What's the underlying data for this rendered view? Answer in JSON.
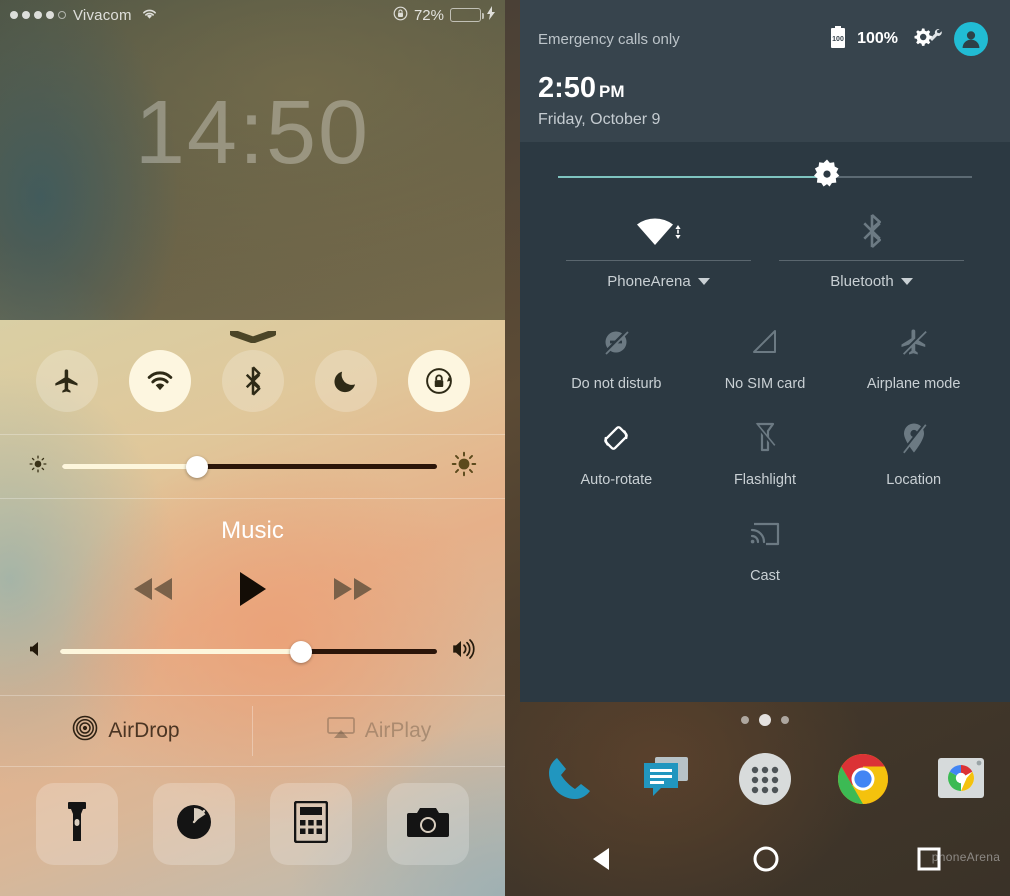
{
  "ios": {
    "status": {
      "signal_dots_filled": 4,
      "signal_dots_total": 5,
      "carrier": "Vivacom",
      "wifi_icon": "wifi-icon",
      "lock_icon": "rotation-lock-icon",
      "battery_percent": "72%",
      "battery_level": 72,
      "charging": true
    },
    "lock_clock": "14:50",
    "control_center": {
      "toggles": [
        {
          "name": "airplane-mode",
          "icon": "airplane-icon",
          "active": false
        },
        {
          "name": "wifi",
          "icon": "wifi-icon",
          "active": true
        },
        {
          "name": "bluetooth",
          "icon": "bluetooth-icon",
          "active": false
        },
        {
          "name": "do-not-disturb",
          "icon": "moon-icon",
          "active": false
        },
        {
          "name": "rotation-lock",
          "icon": "rotation-lock-icon",
          "active": true
        }
      ],
      "brightness": {
        "label": "Brightness",
        "value": 36
      },
      "music": {
        "title": "Music",
        "prev_label": "Previous",
        "play_label": "Play",
        "next_label": "Next",
        "volume": 64
      },
      "share": [
        {
          "label": "AirDrop",
          "icon": "airdrop-icon",
          "enabled": true
        },
        {
          "label": "AirPlay",
          "icon": "airplay-icon",
          "enabled": false
        }
      ],
      "apps": [
        {
          "label": "Flashlight",
          "icon": "flashlight-icon"
        },
        {
          "label": "Timer",
          "icon": "timer-icon"
        },
        {
          "label": "Calculator",
          "icon": "calculator-icon"
        },
        {
          "label": "Camera",
          "icon": "camera-icon"
        }
      ]
    }
  },
  "android": {
    "header": {
      "carrier_status": "Emergency calls only",
      "battery_icon_text": "100",
      "battery_percent": "100%",
      "settings_icon": "gear-wrench-icon",
      "avatar_icon": "user-avatar-icon",
      "time": "2:50",
      "ampm": "PM",
      "date": "Friday, October 9"
    },
    "brightness": {
      "value": 65
    },
    "tiles_primary": [
      {
        "label": "PhoneArena",
        "icon": "wifi-icon",
        "active": true,
        "has_chevron": true
      },
      {
        "label": "Bluetooth",
        "icon": "bluetooth-off-icon",
        "active": false,
        "has_chevron": true
      }
    ],
    "tiles": [
      {
        "label": "Do not disturb",
        "icon": "do-not-disturb-off-icon",
        "active": false
      },
      {
        "label": "No SIM card",
        "icon": "signal-no-sim-icon",
        "active": false
      },
      {
        "label": "Airplane mode",
        "icon": "airplane-off-icon",
        "active": false
      },
      {
        "label": "Auto-rotate",
        "icon": "auto-rotate-icon",
        "active": true
      },
      {
        "label": "Flashlight",
        "icon": "flashlight-off-icon",
        "active": false
      },
      {
        "label": "Location",
        "icon": "location-off-icon",
        "active": false
      },
      {
        "label": "Cast",
        "icon": "cast-icon",
        "active": false
      }
    ],
    "home": {
      "page_dots": 3,
      "current_page": 2,
      "dock": [
        {
          "label": "Phone",
          "icon": "phone-icon"
        },
        {
          "label": "Messenger",
          "icon": "messages-icon"
        },
        {
          "label": "All apps",
          "icon": "app-drawer-icon"
        },
        {
          "label": "Chrome",
          "icon": "chrome-icon"
        },
        {
          "label": "Camera",
          "icon": "camera-icon"
        }
      ],
      "nav": [
        {
          "label": "Back",
          "icon": "back-triangle-icon"
        },
        {
          "label": "Home",
          "icon": "home-circle-icon"
        },
        {
          "label": "Recents",
          "icon": "recents-square-icon"
        }
      ],
      "watermark": "phoneArena"
    }
  },
  "colors": {
    "ios_accent": "#fdf6e0",
    "ios_battery_green": "#4cd964",
    "android_panel": "#2c3942",
    "android_header": "#37444d",
    "android_accent": "#7fc4c0",
    "android_avatar": "#21bcd4"
  }
}
